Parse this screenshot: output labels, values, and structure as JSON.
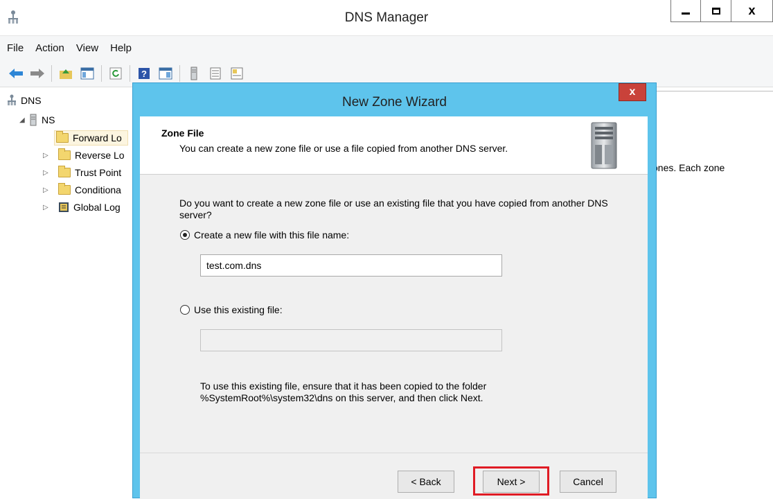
{
  "window": {
    "title": "DNS Manager"
  },
  "menu": [
    "File",
    "Action",
    "View",
    "Help"
  ],
  "toolbar_icons": [
    "back-arrow-icon",
    "forward-arrow-icon",
    "up-folder-icon",
    "console-tree-icon",
    "refresh-icon",
    "help-icon",
    "action-pane-icon",
    "server-icon",
    "list-icon",
    "properties-icon"
  ],
  "tree": {
    "root": "DNS",
    "server": "NS",
    "items": [
      "Forward Lo",
      "Reverse Lo",
      "Trust Point",
      "Conditiona",
      "Global Log"
    ]
  },
  "right_pane_text": "ones. Each zone",
  "dialog": {
    "title": "New Zone Wizard",
    "close": "x",
    "header_title": "Zone File",
    "header_subtitle": "You can create a new zone file or use a file copied from another DNS server.",
    "question": "Do you want to create a new zone file or use an existing file that you have copied from another DNS server?",
    "option_new": "Create a new file with this file name:",
    "new_file_value": "test.com.dns",
    "option_existing": "Use this existing file:",
    "existing_file_value": "",
    "note": "To use this existing file, ensure that it has been copied to the folder %SystemRoot%\\system32\\dns on this server, and then click Next.",
    "back": "< Back",
    "next": "Next >",
    "cancel": "Cancel"
  },
  "colors": {
    "dialog_frame": "#5ec4ec",
    "highlight": "#e01b24",
    "close_button": "#c9423a"
  }
}
